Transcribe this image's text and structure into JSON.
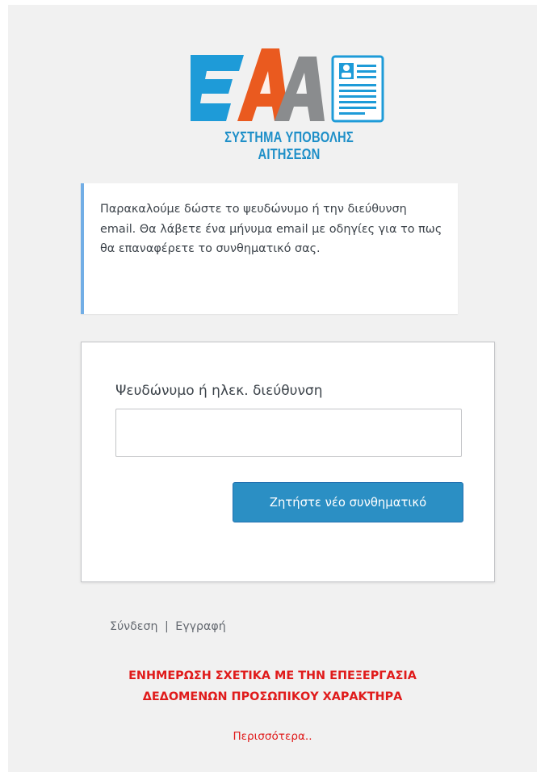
{
  "logo": {
    "caption": "ΣΥΣΤΗΜΑ ΥΠΟΒΟΛΗΣ ΑΙΤΗΣΕΩΝ",
    "colors": {
      "blue": "#1e9bd8",
      "orange": "#ea5a1f",
      "gray": "#8a8c8e",
      "caption": "#1e8fc8"
    }
  },
  "message": {
    "text": "Παρακαλούμε δώστε το ψευδώνυμο ή την διεύθυνση email. Θα λάβετε ένα μήνυμα email με οδηγίες για το πως θα επαναφέρετε το συνθηματικό σας."
  },
  "form": {
    "field_label": "Ψευδώνυμο ή ηλεκ. διεύθυνση",
    "field_value": "",
    "submit_label": "Ζητήστε νέο συνθηματικό"
  },
  "nav": {
    "login": "Σύνδεση",
    "separator": "|",
    "register": "Εγγραφή"
  },
  "gdpr": {
    "line1": "ΕΝΗΜΕΡΩΣΗ ΣΧΕΤΙΚΑ ΜΕ ΤΗΝ ΕΠΕΞΕΡΓΑΣΙΑ",
    "line2": "ΔΕΔΟΜΕΝΩΝ ΠΡΟΣΩΠΙΚΟΥ ΧΑΡΑΚΤΗΡΑ",
    "more": "Περισσότερα.."
  }
}
